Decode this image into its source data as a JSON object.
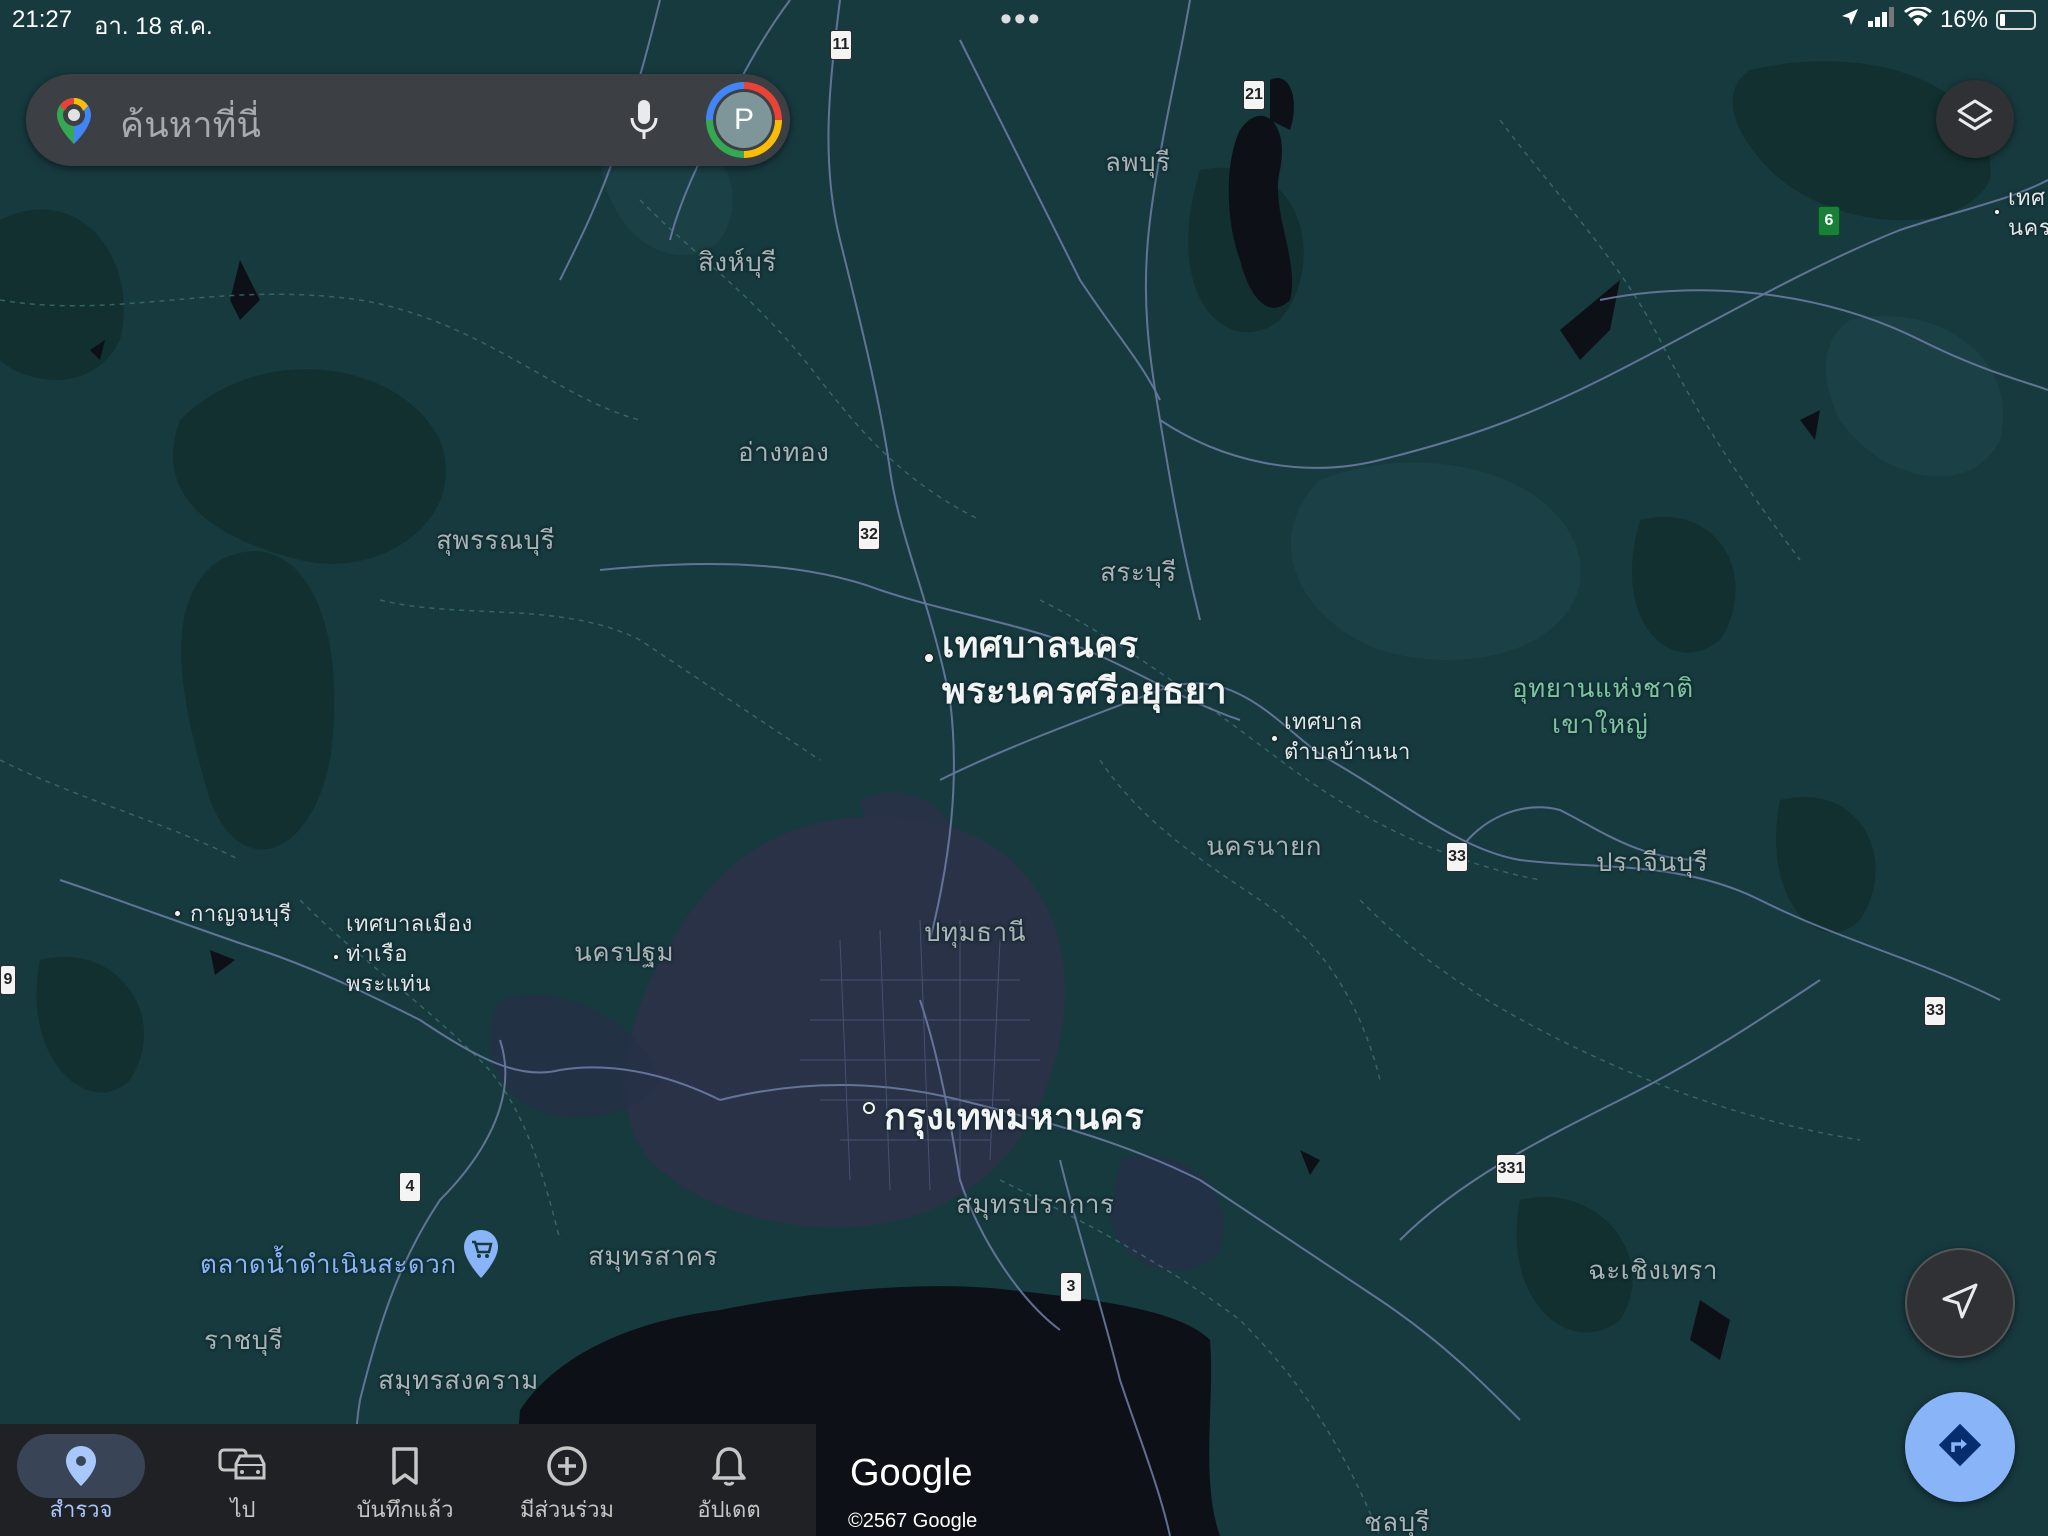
{
  "status_bar": {
    "time": "21:27",
    "date": "อา. 18 ส.ค.",
    "battery_percent": "16%",
    "battery_level": 0.16,
    "icons": [
      "location-arrow-icon",
      "cellular-signal-icon",
      "wifi-icon",
      "battery-icon"
    ]
  },
  "search": {
    "placeholder": "ค้นหาที่นี่",
    "avatar_initial": "P"
  },
  "map": {
    "places": {
      "lopburi": "ลพบุรี",
      "singburi": "สิงห์บุรี",
      "angthong": "อ่างทอง",
      "suphanburi": "สุพรรณบุรี",
      "saraburi": "สระบุรี",
      "ayutthaya_line1": "เทศบาลนคร",
      "ayutthaya_line2": "พระนครศรีอยุธยา",
      "bannanadistrict_line1": "เทศบาล",
      "bannanadistrict_line2": "ตำบลบ้านนา",
      "park_line1": "อุทยานแห่งชาติ",
      "park_line2": "เขาใหญ่",
      "nakhonnayok": "นครนายก",
      "prachinburi": "ปราจีนบุรี",
      "pathumthani": "ปทุมธานี",
      "kanchanaburi": "กาญจนบุรี",
      "thamuang_line1": "เทศบาลเมือง",
      "thamuang_line2": "ท่าเรือ",
      "thamuang_line3": "พระแท่น",
      "nakhonpathom": "นครปฐม",
      "bangkok": "กรุงเทพมหานคร",
      "samutprakan": "สมุทรปราการ",
      "samutsakhon": "สมุทรสาคร",
      "floating_market": "ตลาดน้ำดำเนินสะดวก",
      "ratchaburi": "ราชบุรี",
      "samutsongkhram": "สมุทรสงคราม",
      "chachoengsao": "ฉะเชิงเทรา",
      "chonburi": "ชลบุรี",
      "edge_label1": "เทศ",
      "edge_label2": "นคร"
    },
    "route_shields": {
      "r11": "11",
      "r21": "21",
      "r6": "6",
      "r32": "32",
      "r33a": "33",
      "r33b": "33",
      "r331": "331",
      "r4": "4",
      "r3": "3",
      "r_edge": "9"
    },
    "colors": {
      "land": "#173a3f",
      "urban": "#2a3247",
      "water": "#0d1117",
      "road": "#6f7fa8"
    }
  },
  "bottom_nav": {
    "items": [
      {
        "label": "สำรวจ",
        "icon": "location-pin-icon",
        "active": true
      },
      {
        "label": "ไป",
        "icon": "car-commute-icon",
        "active": false
      },
      {
        "label": "บันทึกแล้ว",
        "icon": "bookmark-icon",
        "active": false
      },
      {
        "label": "มีส่วนร่วม",
        "icon": "add-circle-icon",
        "active": false
      },
      {
        "label": "อัปเดต",
        "icon": "bell-icon",
        "active": false
      }
    ]
  },
  "attribution": {
    "logo": "Google",
    "copyright": "©2567 Google"
  }
}
